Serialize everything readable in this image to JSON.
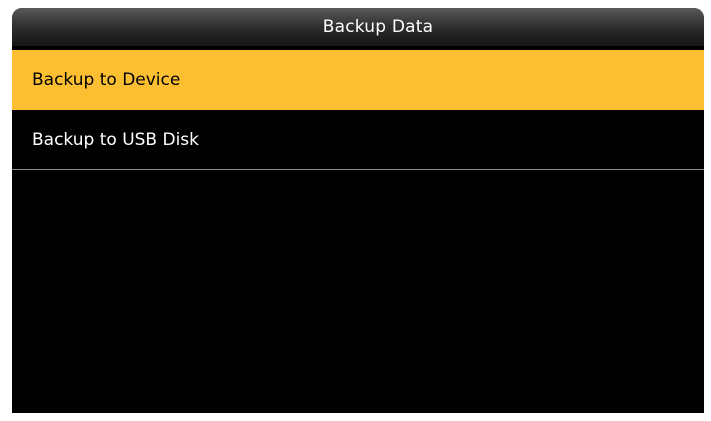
{
  "window": {
    "title": "Backup Data"
  },
  "menu": {
    "items": [
      {
        "label": "Backup to Device",
        "selected": true
      },
      {
        "label": "Backup to USB Disk",
        "selected": false
      }
    ]
  },
  "colors": {
    "highlight": "#fdbf32",
    "background": "#000000",
    "divider": "#8a8a8a"
  }
}
